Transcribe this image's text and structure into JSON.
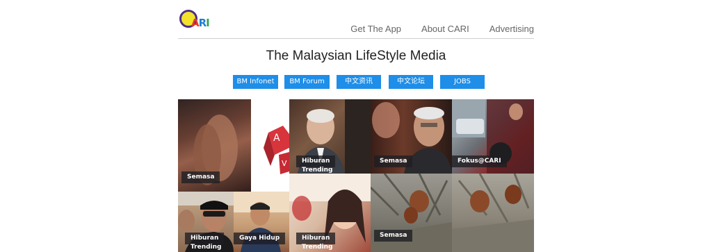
{
  "logo": {
    "text_parts": [
      "A",
      "R",
      "I"
    ]
  },
  "nav": {
    "items": [
      "Get The App",
      "About CARI",
      "Advertising"
    ]
  },
  "tagline": "The Malaysian LifeStyle Media",
  "categories": [
    "BM Infonet",
    "BM Forum",
    "中文资讯",
    "中文论坛",
    "JOBS"
  ],
  "tiles": [
    {
      "label": "Semasa",
      "sub": ""
    },
    {
      "label": "",
      "sub": ""
    },
    {
      "label": "Hiburan",
      "sub": "Trending"
    },
    {
      "label": "Semasa",
      "sub": ""
    },
    {
      "label": "Fokus@CARI",
      "sub": ""
    },
    {
      "label": "Hiburan",
      "sub": "Trending"
    },
    {
      "label": "Gaya Hidup",
      "sub": ""
    },
    {
      "label": "Hiburan",
      "sub": "Trending"
    },
    {
      "label": "Semasa",
      "sub": ""
    },
    {
      "label": "",
      "sub": ""
    }
  ],
  "colors": {
    "button": "#1e8ee8",
    "label_bg": "#1e1e23",
    "logo_yellow": "#f2e22b",
    "logo_purple": "#4b2f86"
  }
}
